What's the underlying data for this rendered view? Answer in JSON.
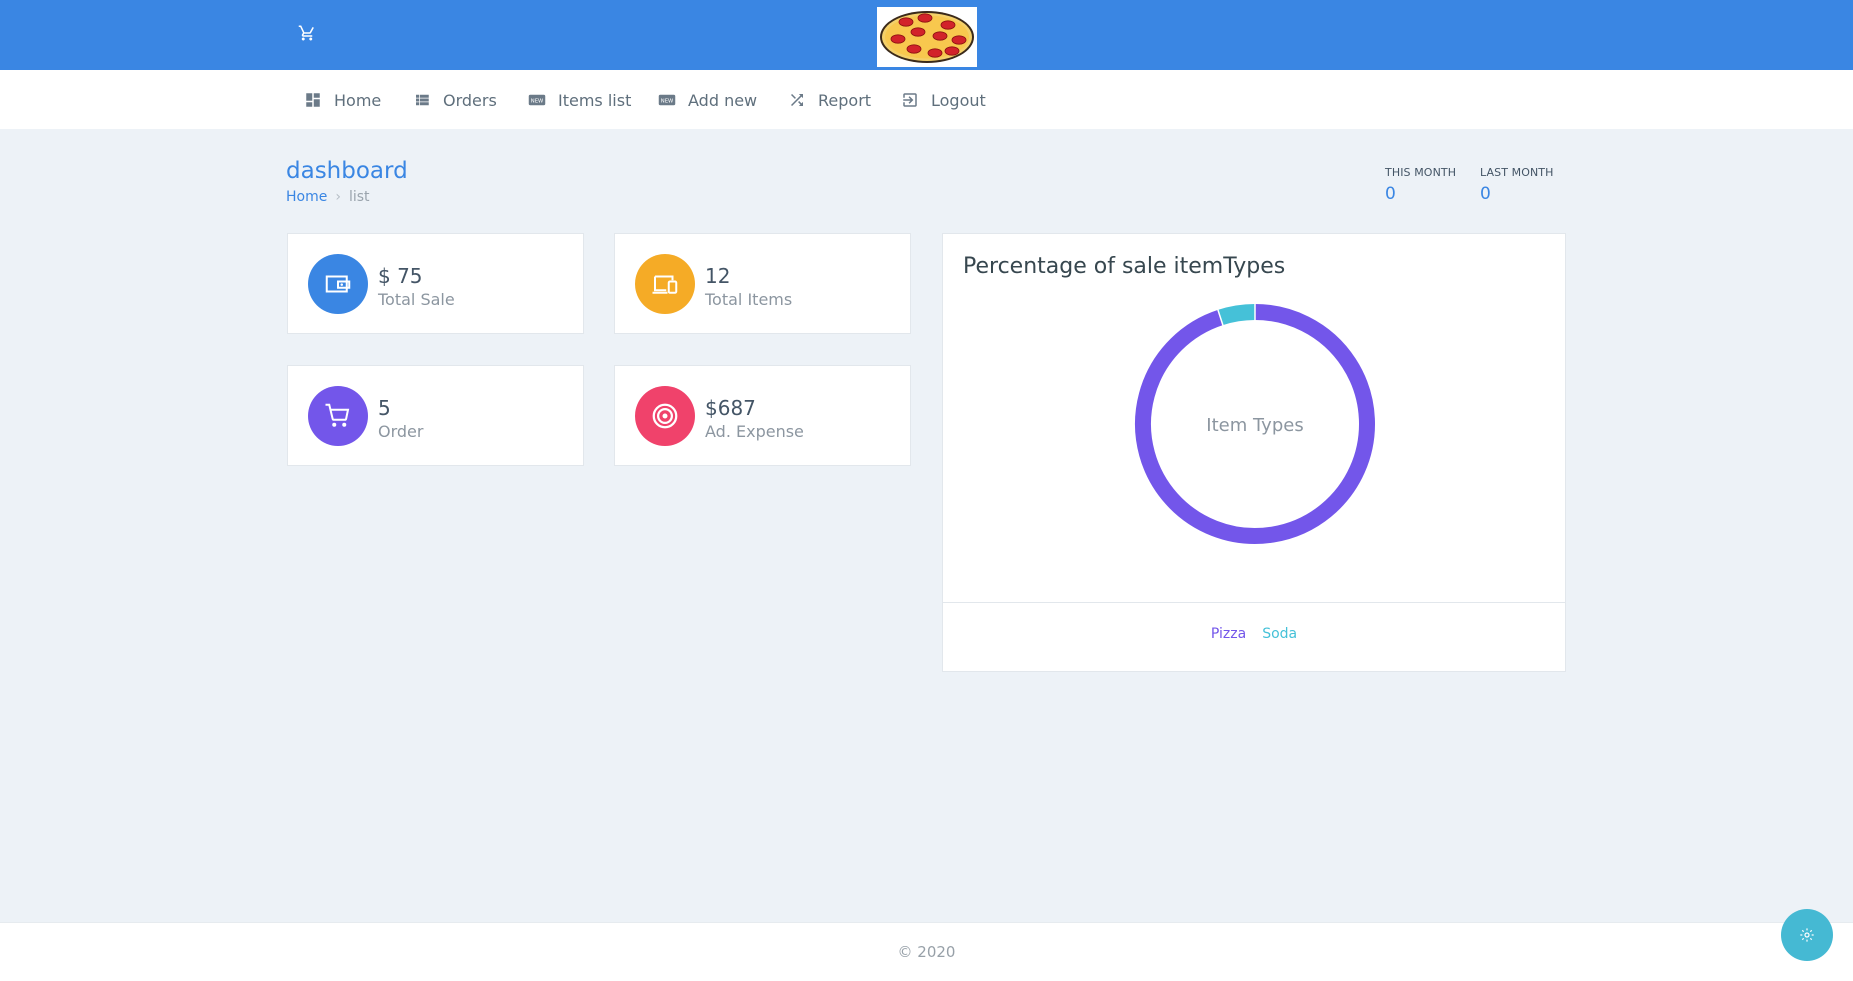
{
  "header": {
    "cart_icon": "cart-icon",
    "logo": "pizza-logo"
  },
  "nav": {
    "items": [
      {
        "label": "Home",
        "icon": "dashboard-icon"
      },
      {
        "label": "Orders",
        "icon": "list-icon"
      },
      {
        "label": "Items list",
        "icon": "new-badge-icon"
      },
      {
        "label": "Add new",
        "icon": "new-badge-icon"
      },
      {
        "label": "Report",
        "icon": "shuffle-icon"
      },
      {
        "label": "Logout",
        "icon": "logout-icon"
      }
    ]
  },
  "page": {
    "title": "dashboard",
    "breadcrumb": {
      "home": "Home",
      "separator": "›",
      "current": "list"
    }
  },
  "months": {
    "this_month_label": "THIS MONTH",
    "this_month_value": "0",
    "last_month_label": "LAST MONTH",
    "last_month_value": "0"
  },
  "stats": [
    {
      "value": "$ 75",
      "label": "Total Sale",
      "icon": "wallet-icon",
      "color": "#3a86e3"
    },
    {
      "value": "12",
      "label": "Total Items",
      "icon": "devices-icon",
      "color": "#f5ab26"
    },
    {
      "value": "5",
      "label": "Order",
      "icon": "cart-icon",
      "color": "#7356ea"
    },
    {
      "value": "$687",
      "label": "Ad. Expense",
      "icon": "target-icon",
      "color": "#f0426b"
    }
  ],
  "chart_data": {
    "type": "pie",
    "title": "Percentage of sale itemTypes",
    "center_label": "Item Types",
    "series": [
      {
        "name": "Pizza",
        "value": 95,
        "color": "#7356ea"
      },
      {
        "name": "Soda",
        "value": 5,
        "color": "#45c1d8"
      }
    ],
    "legend_position": "bottom"
  },
  "footer": {
    "text": "© 2020",
    "settings_icon": "gear-icon"
  }
}
